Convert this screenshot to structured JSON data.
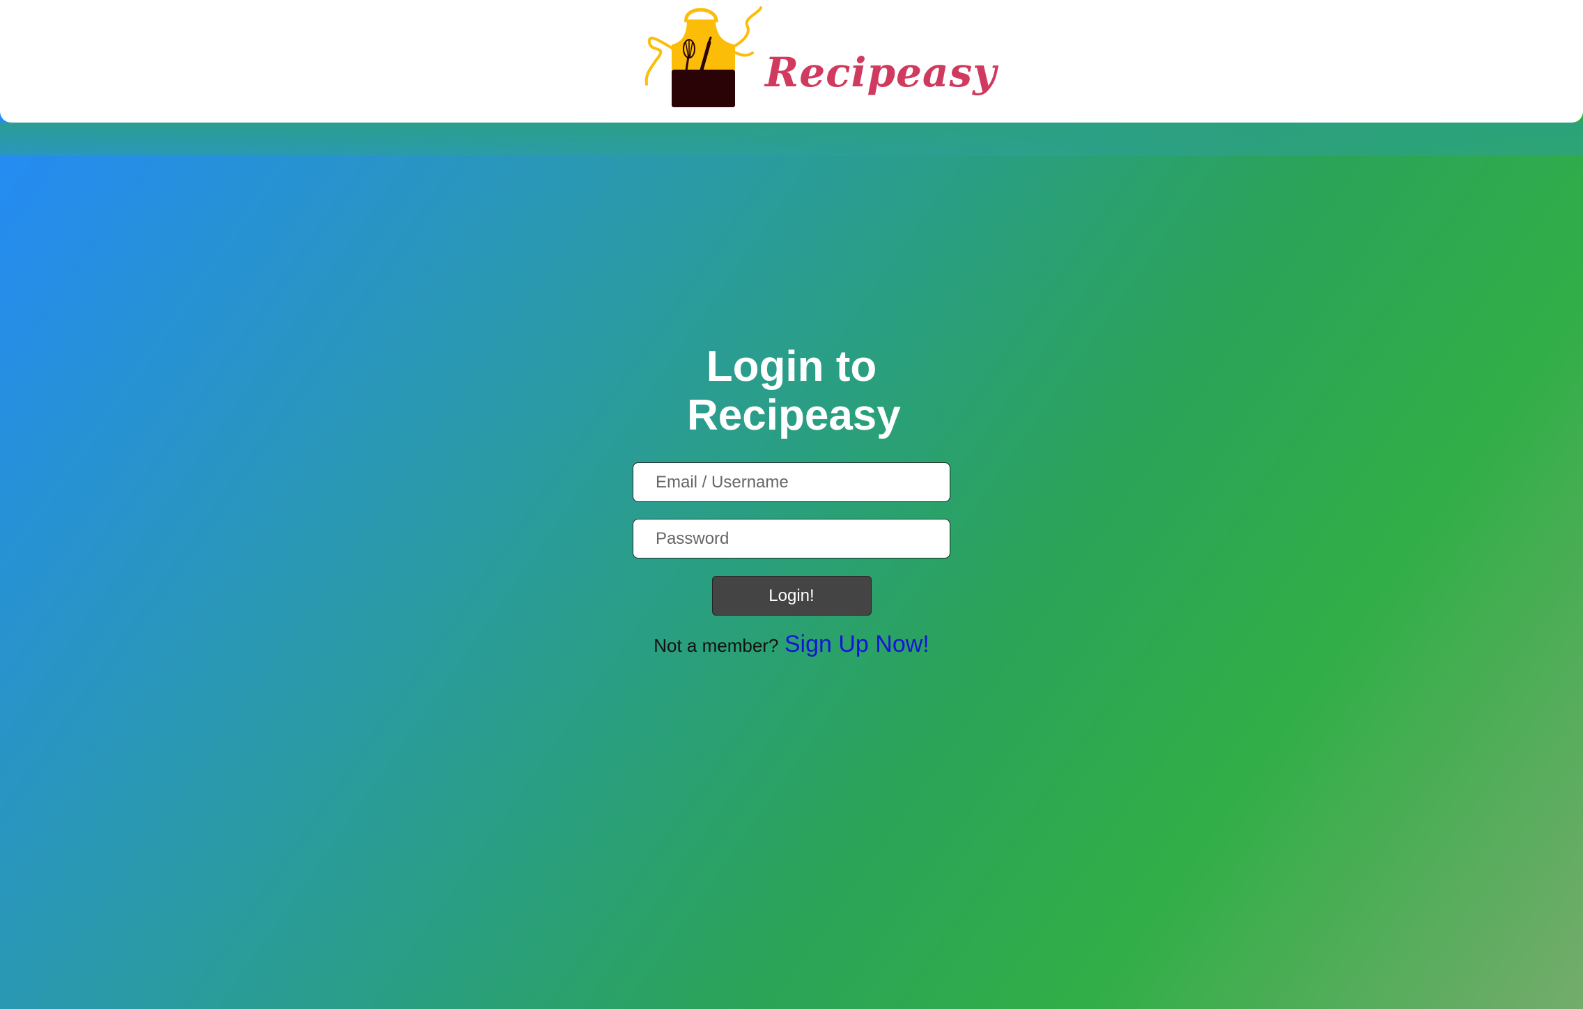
{
  "brand": {
    "name": "Recipeasy",
    "logo_icon": "apron-icon",
    "name_color": "#d03a5e"
  },
  "login": {
    "title": "Login to Recipeasy",
    "email_placeholder": "Email / Username",
    "password_placeholder": "Password",
    "submit_label": "Login!",
    "not_member_text": "Not a member?",
    "signup_link_text": "Sign Up Now!"
  },
  "colors": {
    "header_bg": "#ffffff",
    "background_gradient": [
      "#2489ff",
      "#2a9aa8",
      "#31ae47",
      "#74ac6c"
    ],
    "button_bg": "#444444",
    "link_color": "#1414d8",
    "apron_yellow": "#fbbd08",
    "apron_dark": "#2a0306"
  }
}
